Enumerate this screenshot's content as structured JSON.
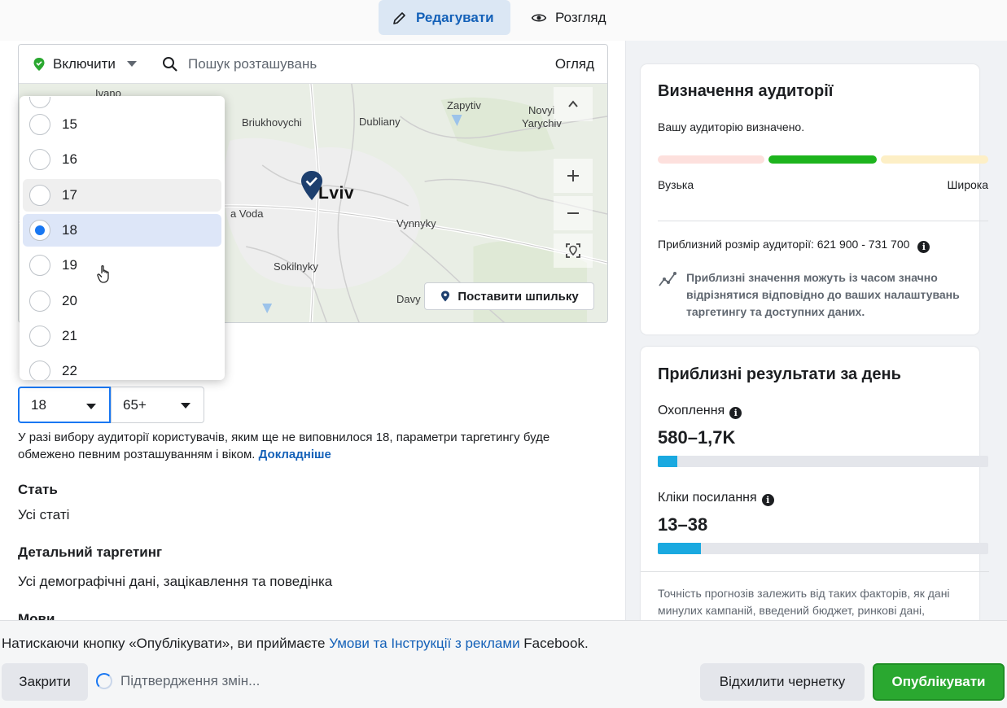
{
  "tabs": {
    "edit": "Редагувати",
    "view": "Розгляд"
  },
  "location": {
    "include_label": "Включити",
    "search_placeholder": "Пошук розташувань",
    "browse_label": "Огляд",
    "map_places": [
      "Ivano",
      "Briukhovychi",
      "Dubliany",
      "Zapytiv",
      "Novyi",
      "Yarychiv",
      "Lviv",
      "a Voda",
      "Vynnyky",
      "Sokilnyky",
      "Davy"
    ],
    "drop_pin_label": "Поставити шпильку",
    "colors": {
      "pin": "#1d3f6e",
      "include_icon": "#2aa830"
    }
  },
  "age_dropdown": {
    "options": [
      "15",
      "16",
      "17",
      "18",
      "19",
      "20",
      "21",
      "22"
    ],
    "selected": "18",
    "hovered": "17"
  },
  "age_range": {
    "min": "18",
    "max": "65+"
  },
  "age_note": {
    "text": "У разі вибору аудиторії користувачів, яким ще не виповнилося 18, параметри таргетингу буде обмежено певним розташуванням і віком.",
    "link": "Докладніше"
  },
  "gender": {
    "title": "Стать",
    "value": "Усі статі"
  },
  "detailed_targeting": {
    "title": "Детальний таргетинг",
    "value": "Усі демографічні дані, зацікавлення та поведінка"
  },
  "languages": {
    "title": "Мови"
  },
  "audience_definition": {
    "title": "Визначення аудиторії",
    "status": "Вашу аудиторію визначено.",
    "narrow_label": "Вузька",
    "broad_label": "Широка",
    "meter_colors": [
      "#fde0dd",
      "#1db41d",
      "#fdefc6"
    ],
    "size_label": "Приблизний розмір аудиторії:",
    "size_value": "621 900 - 731 700",
    "disclaimer": "Приблизні значення можуть із часом значно відрізнятися відповідно до ваших налаштувань таргетингу та доступних даних."
  },
  "daily_results": {
    "title": "Приблизні результати за день",
    "reach_label": "Охоплення",
    "reach_value": "580–1,7K",
    "reach_fill": 0.06,
    "clicks_label": "Кліки посилання",
    "clicks_value": "13–38",
    "clicks_fill": 0.13,
    "footnote": "Точність прогнозів залежить від таких факторів, як дані минулих кампаній, введений бюджет, ринкові дані,"
  },
  "footer": {
    "terms_prefix": "Натискаючи кнопку «Опублікувати», ви приймаєте",
    "terms_link": "Умови та Інструкції з реклами",
    "terms_suffix": "Facebook.",
    "close_label": "Закрити",
    "pending_label": "Підтвердження змін...",
    "reject_label": "Відхилити чернетку",
    "publish_label": "Опублікувати"
  }
}
